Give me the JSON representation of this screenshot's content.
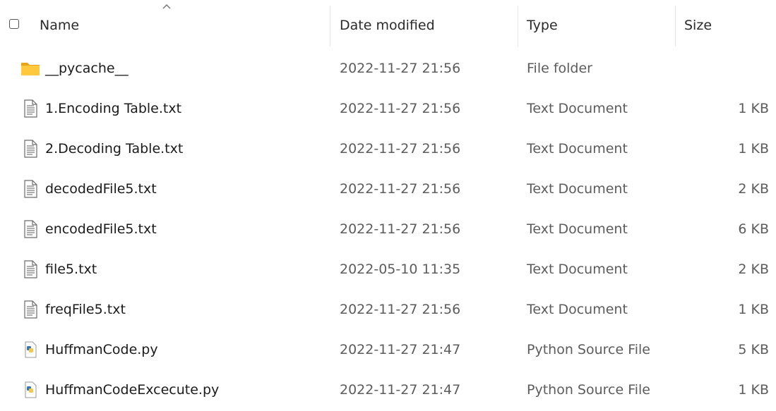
{
  "header": {
    "name_label": "Name",
    "date_label": "Date modified",
    "type_label": "Type",
    "size_label": "Size",
    "sort_direction": "ascending"
  },
  "files": [
    {
      "name": "__pycache__",
      "date": "2022-11-27 21:56",
      "type": "File folder",
      "size": "",
      "icon": "folder-icon"
    },
    {
      "name": "1.Encoding Table.txt",
      "date": "2022-11-27 21:56",
      "type": "Text Document",
      "size": "1 KB",
      "icon": "text-file-icon"
    },
    {
      "name": "2.Decoding Table.txt",
      "date": "2022-11-27 21:56",
      "type": "Text Document",
      "size": "1 KB",
      "icon": "text-file-icon"
    },
    {
      "name": "decodedFile5.txt",
      "date": "2022-11-27 21:56",
      "type": "Text Document",
      "size": "2 KB",
      "icon": "text-file-icon"
    },
    {
      "name": "encodedFile5.txt",
      "date": "2022-11-27 21:56",
      "type": "Text Document",
      "size": "6 KB",
      "icon": "text-file-icon"
    },
    {
      "name": "file5.txt",
      "date": "2022-05-10 11:35",
      "type": "Text Document",
      "size": "2 KB",
      "icon": "text-file-icon"
    },
    {
      "name": "freqFile5.txt",
      "date": "2022-11-27 21:56",
      "type": "Text Document",
      "size": "1 KB",
      "icon": "text-file-icon"
    },
    {
      "name": "HuffmanCode.py",
      "date": "2022-11-27 21:47",
      "type": "Python Source File",
      "size": "5 KB",
      "icon": "python-file-icon"
    },
    {
      "name": "HuffmanCodeExcecute.py",
      "date": "2022-11-27 21:47",
      "type": "Python Source File",
      "size": "1 KB",
      "icon": "python-file-icon"
    }
  ],
  "colors": {
    "folder": "#ffc83d",
    "folder_dark": "#e8a317",
    "python_blue": "#3a75b0",
    "python_yellow": "#f2c94c"
  }
}
